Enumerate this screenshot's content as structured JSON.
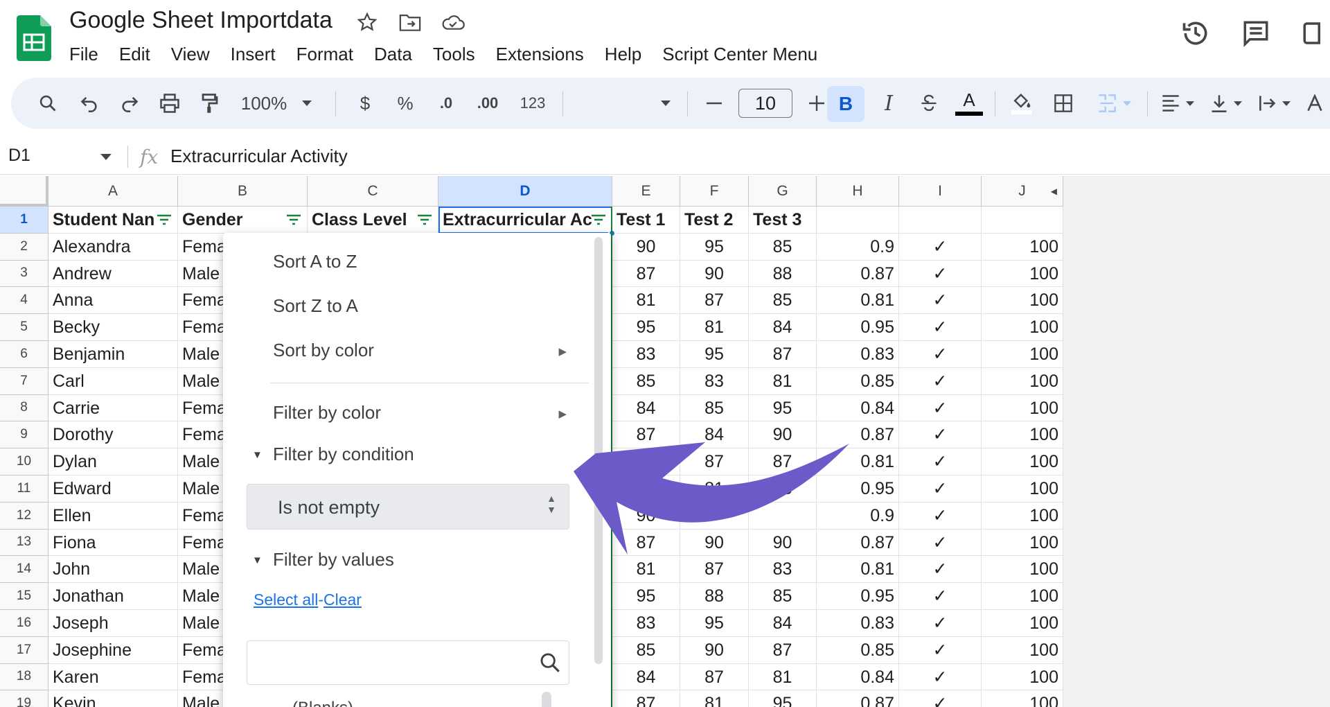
{
  "document": {
    "title": "Google Sheet Importdata"
  },
  "menu": [
    "File",
    "Edit",
    "View",
    "Insert",
    "Format",
    "Data",
    "Tools",
    "Extensions",
    "Help",
    "Script Center Menu"
  ],
  "toolbar": {
    "zoom": "100%",
    "currency": "$",
    "percent": "%",
    "decrease_decimal": ".0",
    "increase_decimal": ".00",
    "number_format": "123",
    "font_size": "10",
    "bold": "B",
    "italic": "I",
    "text_color": "A"
  },
  "formula_bar": {
    "cell_ref": "D1",
    "fx": "fx",
    "content": "Extracurricular Activity"
  },
  "columns": [
    "A",
    "B",
    "C",
    "D",
    "E",
    "F",
    "G",
    "H",
    "I",
    "J"
  ],
  "header_row": [
    "Student Nan",
    "Gender",
    "Class Level",
    "Extracurricular Ac",
    "Test 1",
    "Test 2",
    "Test 3",
    "",
    "",
    ""
  ],
  "rows": [
    {
      "n": "2",
      "a": "Alexandra",
      "b": "Fema",
      "e": "90",
      "f": "95",
      "g": "85",
      "h": "0.9",
      "i": "✓",
      "j": "100"
    },
    {
      "n": "3",
      "a": "Andrew",
      "b": "Male",
      "e": "87",
      "f": "90",
      "g": "88",
      "h": "0.87",
      "i": "✓",
      "j": "100"
    },
    {
      "n": "4",
      "a": "Anna",
      "b": "Fema",
      "e": "81",
      "f": "87",
      "g": "85",
      "h": "0.81",
      "i": "✓",
      "j": "100"
    },
    {
      "n": "5",
      "a": "Becky",
      "b": "Fema",
      "e": "95",
      "f": "81",
      "g": "84",
      "h": "0.95",
      "i": "✓",
      "j": "100"
    },
    {
      "n": "6",
      "a": "Benjamin",
      "b": "Male",
      "e": "83",
      "f": "95",
      "g": "87",
      "h": "0.83",
      "i": "✓",
      "j": "100"
    },
    {
      "n": "7",
      "a": "Carl",
      "b": "Male",
      "e": "85",
      "f": "83",
      "g": "81",
      "h": "0.85",
      "i": "✓",
      "j": "100"
    },
    {
      "n": "8",
      "a": "Carrie",
      "b": "Fema",
      "e": "84",
      "f": "85",
      "g": "95",
      "h": "0.84",
      "i": "✓",
      "j": "100"
    },
    {
      "n": "9",
      "a": "Dorothy",
      "b": "Fema",
      "e": "87",
      "f": "84",
      "g": "90",
      "h": "0.87",
      "i": "✓",
      "j": "100"
    },
    {
      "n": "10",
      "a": "Dylan",
      "b": "Male",
      "e": "",
      "f": "87",
      "g": "87",
      "h": "0.81",
      "i": "✓",
      "j": "100"
    },
    {
      "n": "11",
      "a": "Edward",
      "b": "Male",
      "e": "",
      "f": "81",
      "g": "88",
      "h": "0.95",
      "i": "✓",
      "j": "100"
    },
    {
      "n": "12",
      "a": "Ellen",
      "b": "Fema",
      "e": "90",
      "f": "",
      "g": "",
      "h": "0.9",
      "i": "✓",
      "j": "100"
    },
    {
      "n": "13",
      "a": "Fiona",
      "b": "Fema",
      "e": "87",
      "f": "90",
      "g": "90",
      "h": "0.87",
      "i": "✓",
      "j": "100"
    },
    {
      "n": "14",
      "a": "John",
      "b": "Male",
      "e": "81",
      "f": "87",
      "g": "83",
      "h": "0.81",
      "i": "✓",
      "j": "100"
    },
    {
      "n": "15",
      "a": "Jonathan",
      "b": "Male",
      "e": "95",
      "f": "88",
      "g": "85",
      "h": "0.95",
      "i": "✓",
      "j": "100"
    },
    {
      "n": "16",
      "a": "Joseph",
      "b": "Male",
      "e": "83",
      "f": "95",
      "g": "84",
      "h": "0.83",
      "i": "✓",
      "j": "100"
    },
    {
      "n": "17",
      "a": "Josephine",
      "b": "Fema",
      "e": "85",
      "f": "90",
      "g": "87",
      "h": "0.85",
      "i": "✓",
      "j": "100"
    },
    {
      "n": "18",
      "a": "Karen",
      "b": "Fema",
      "e": "84",
      "f": "87",
      "g": "81",
      "h": "0.84",
      "i": "✓",
      "j": "100"
    },
    {
      "n": "19",
      "a": "Kevin",
      "b": "Male",
      "e": "87",
      "f": "81",
      "g": "95",
      "h": "0.87",
      "i": "✓",
      "j": "100"
    }
  ],
  "filter_menu": {
    "sort_az": "Sort A to Z",
    "sort_za": "Sort Z to A",
    "sort_color": "Sort by color",
    "filter_color": "Filter by color",
    "filter_condition": "Filter by condition",
    "condition_value": "Is not empty",
    "filter_values": "Filter by values",
    "select_all": "Select all",
    "link_separator": "-",
    "clear": "Clear",
    "blanks": "(Blanks)"
  },
  "colors": {
    "accent_blue": "#1a73e8",
    "selected_header": "#d3e3fd",
    "filter_green": "#188038",
    "annotation_arrow": "#6b5bc9"
  }
}
